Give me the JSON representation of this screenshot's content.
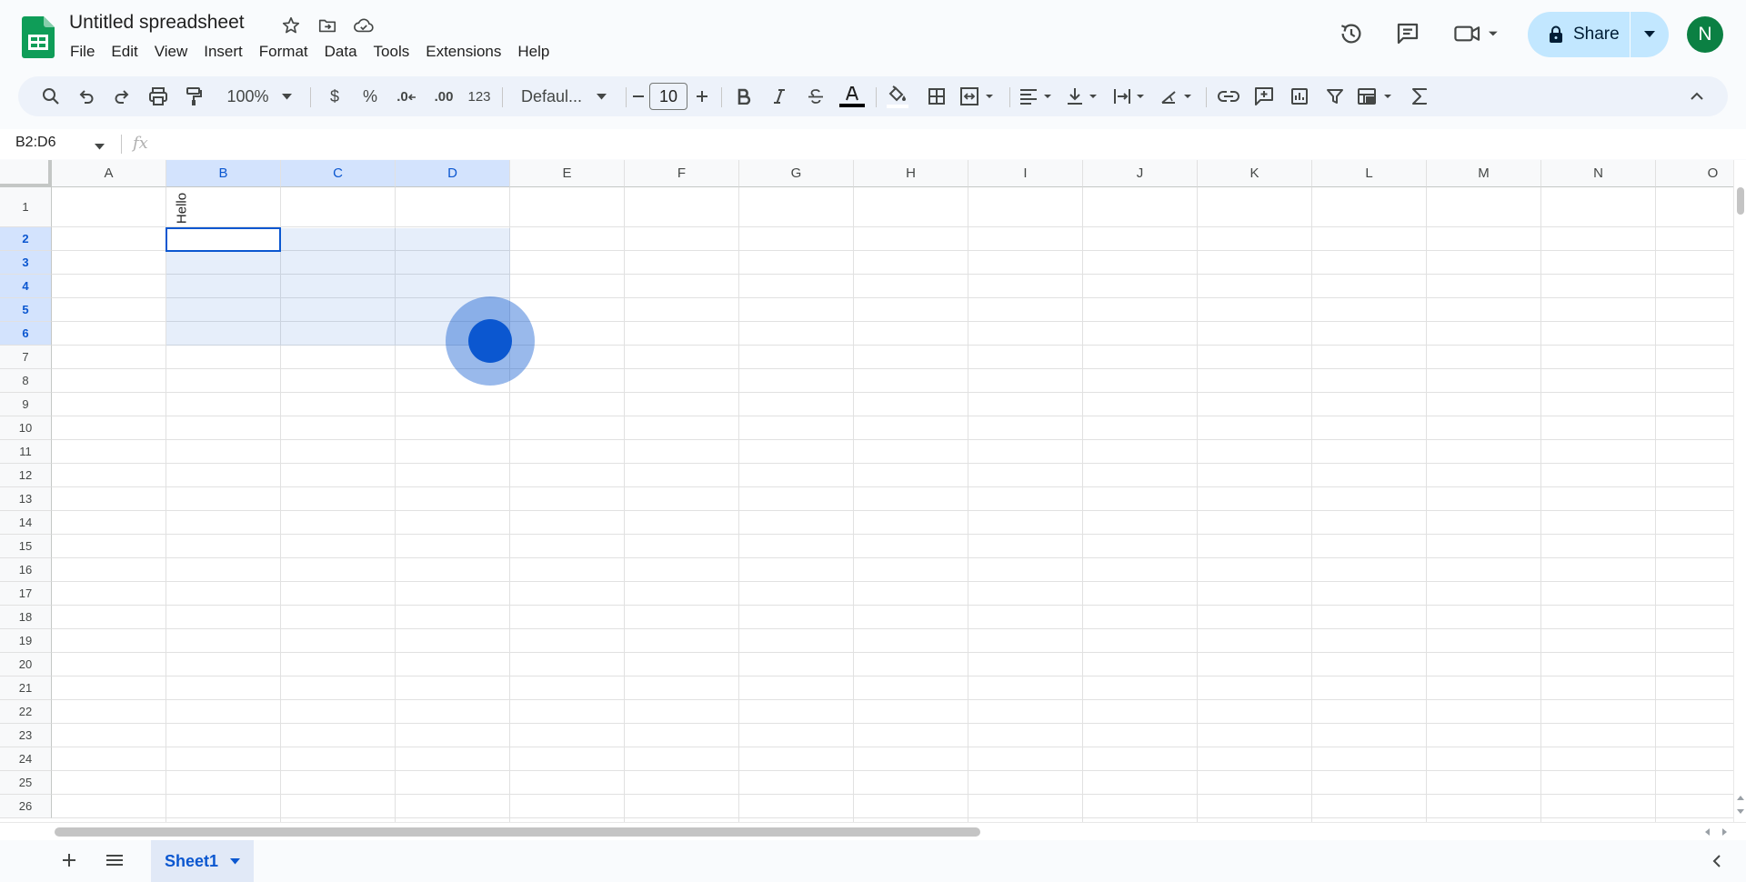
{
  "header": {
    "title": "Untitled spreadsheet",
    "avatar_initial": "N",
    "share_label": "Share"
  },
  "menu": [
    "File",
    "Edit",
    "View",
    "Insert",
    "Format",
    "Data",
    "Tools",
    "Extensions",
    "Help"
  ],
  "toolbar": {
    "zoom": "100%",
    "currency": "$",
    "percent": "%",
    "decrease_decimal": ".0",
    "increase_decimal": ".00",
    "number_format": "123",
    "font": "Defaul...",
    "font_size": "10"
  },
  "formula_bar": {
    "name_box": "B2:D6",
    "fx": "fx"
  },
  "grid": {
    "columns": [
      "A",
      "B",
      "C",
      "D",
      "E",
      "F",
      "G",
      "H",
      "I",
      "J",
      "K",
      "L",
      "M",
      "N",
      "O"
    ],
    "rows": [
      "1",
      "2",
      "3",
      "4",
      "5",
      "6",
      "7",
      "8",
      "9",
      "10",
      "11",
      "12",
      "13",
      "14",
      "15",
      "16",
      "17",
      "18",
      "19",
      "20",
      "21",
      "22",
      "23",
      "24",
      "25",
      "26"
    ],
    "selected_columns": [
      "B",
      "C",
      "D"
    ],
    "selected_rows": [
      "2",
      "3",
      "4",
      "5",
      "6"
    ],
    "cell_b1": "Hello"
  },
  "sheets": {
    "active": "Sheet1"
  },
  "colors": {
    "accent": "#0b57d0",
    "selection_header": "#d3e3fd",
    "share_button": "#c2e7ff",
    "avatar": "#0b8043",
    "logo": "#0f9d58"
  }
}
